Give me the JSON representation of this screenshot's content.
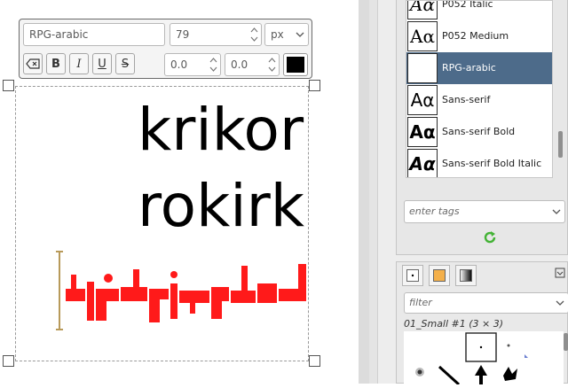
{
  "text_toolbar": {
    "font_name": "RPG-arabic",
    "font_size": "79",
    "unit": "px",
    "letter_spacing": "0.0",
    "line_spacing": "0.0",
    "color": "#000000",
    "buttons": {
      "clear_icon": "eraser-icon",
      "bold": "B",
      "italic": "I",
      "underline": "U",
      "strikethrough": "S"
    }
  },
  "canvas": {
    "line1": "krikor",
    "line2": "rokirk",
    "arabic_color": "#ff0000"
  },
  "fonts_panel": {
    "preview_glyph": "Aα",
    "fonts": [
      {
        "name": "P052 Italic"
      },
      {
        "name": "P052 Medium"
      },
      {
        "name": "RPG-arabic"
      },
      {
        "name": "Sans-serif"
      },
      {
        "name": "Sans-serif Bold"
      },
      {
        "name": "Sans-serif Bold Italic"
      }
    ],
    "selected_index": 2,
    "tags_placeholder": "enter tags"
  },
  "brushes_panel": {
    "filter_placeholder": "filter",
    "brush_label": "01_Small #1 (3 × 3)"
  }
}
